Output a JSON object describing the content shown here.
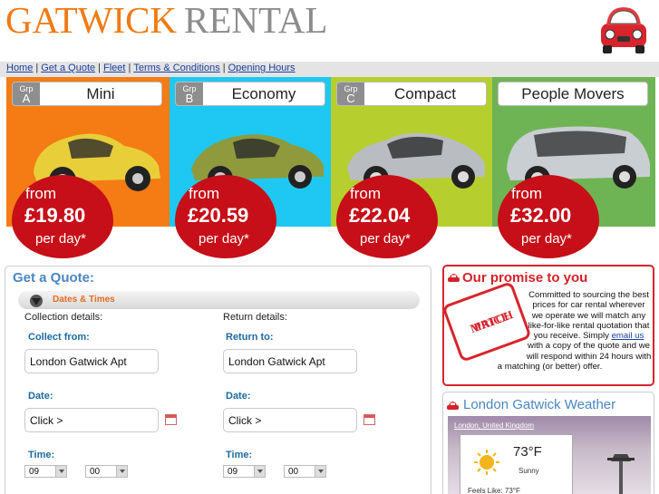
{
  "header": {
    "logo_part1": "GATWICK",
    "logo_part2": "RENTAL"
  },
  "nav": {
    "items": [
      "Home",
      "Get a Quote",
      "Fleet",
      "Terms & Conditions",
      "Opening Hours"
    ],
    "separator": "|"
  },
  "groups": [
    {
      "grp_label": "Grp",
      "grp_letter": "A",
      "name": "Mini",
      "from": "from",
      "price": "£19.80",
      "per_day": "per day*",
      "bg_color": "#f57b14",
      "car_color": "#e8cf3a"
    },
    {
      "grp_label": "Grp",
      "grp_letter": "B",
      "name": "Economy",
      "from": "from",
      "price": "£20.59",
      "per_day": "per day*",
      "bg_color": "#1ec8f2",
      "car_color": "#8e9a3c"
    },
    {
      "grp_label": "Grp",
      "grp_letter": "C",
      "name": "Compact",
      "from": "from",
      "price": "£22.04",
      "per_day": "per day*",
      "bg_color": "#b6cf2e",
      "car_color": "#b9bcc0"
    },
    {
      "grp_label": "",
      "grp_letter": "",
      "name": "People Movers",
      "from": "from",
      "price": "£32.00",
      "per_day": "per day*",
      "bg_color": "#6fb454",
      "car_color": "#c9ced3"
    }
  ],
  "quote": {
    "title": "Get a Quote:",
    "section": "Dates & Times",
    "collection_label": "Collection details:",
    "return_label": "Return details:",
    "collect_from_label": "Collect from:",
    "return_to_label": "Return to:",
    "collect_from_value": "London Gatwick Apt",
    "return_to_value": "London Gatwick Apt",
    "date_label": "Date:",
    "date_value": "Click >",
    "time_label": "Time:",
    "hour": "09",
    "minute": "00"
  },
  "promise": {
    "title": "Our promise to you",
    "stamp_line1": "PRICE",
    "stamp_line2": "MATCH",
    "text_before": "Committed to sourcing the best prices for car rental wherever we operate we will match any like-for-like rental quotation that you receive. Simply",
    "link": "email us",
    "text_after": "with a copy of the quote and we will respond within 24 hours with a matching (or better) offer."
  },
  "weather": {
    "title": "London Gatwick Weather",
    "location": "London, United Kingdom",
    "temp": "73°F",
    "condition": "Sunny",
    "feels_like": "Feels Like: 73°F"
  },
  "colors": {
    "accent_orange": "#f07a14",
    "badge_red": "#c60f18",
    "link_blue": "#1a3f9c",
    "heading_blue": "#4a86c4",
    "promise_red": "#d32229"
  }
}
